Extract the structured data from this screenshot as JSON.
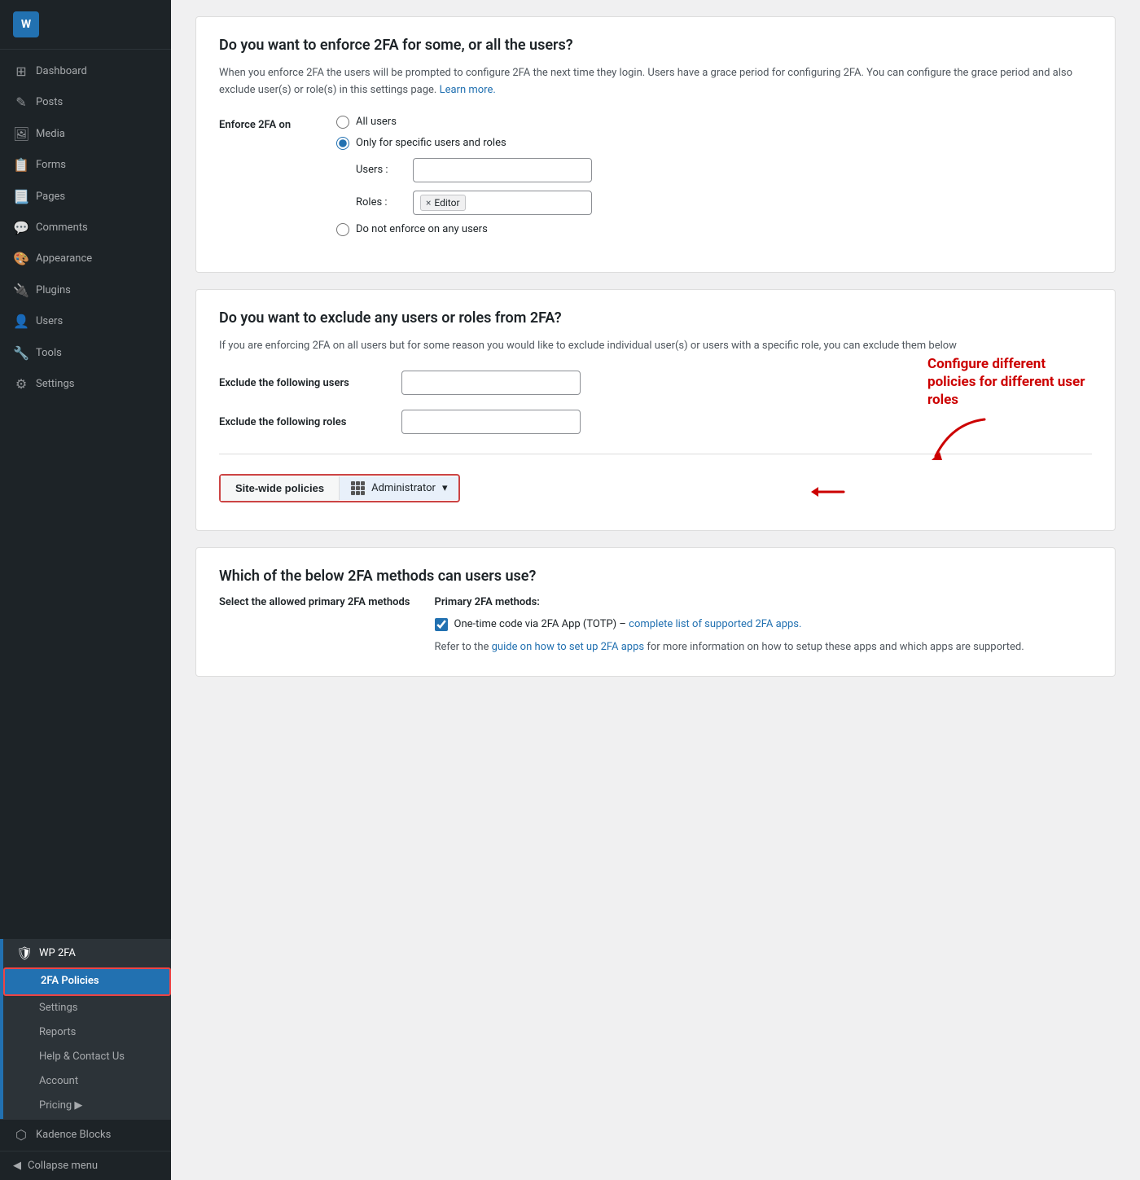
{
  "sidebar": {
    "logo": {
      "text": "W"
    },
    "items": [
      {
        "id": "dashboard",
        "label": "Dashboard",
        "icon": "⊞"
      },
      {
        "id": "posts",
        "label": "Posts",
        "icon": "📄"
      },
      {
        "id": "media",
        "label": "Media",
        "icon": "🖼"
      },
      {
        "id": "forms",
        "label": "Forms",
        "icon": "📋"
      },
      {
        "id": "pages",
        "label": "Pages",
        "icon": "📃"
      },
      {
        "id": "comments",
        "label": "Comments",
        "icon": "💬"
      },
      {
        "id": "appearance",
        "label": "Appearance",
        "icon": "🎨"
      },
      {
        "id": "plugins",
        "label": "Plugins",
        "icon": "🔌"
      },
      {
        "id": "users",
        "label": "Users",
        "icon": "👤"
      },
      {
        "id": "tools",
        "label": "Tools",
        "icon": "🔧"
      },
      {
        "id": "settings",
        "label": "Settings",
        "icon": "⚙"
      }
    ],
    "wp2fa": {
      "label": "WP 2FA",
      "icon": "🛡"
    },
    "submenu": [
      {
        "id": "2fa-policies",
        "label": "2FA Policies",
        "active": true
      },
      {
        "id": "settings",
        "label": "Settings"
      },
      {
        "id": "reports",
        "label": "Reports"
      },
      {
        "id": "help",
        "label": "Help & Contact Us"
      },
      {
        "id": "account",
        "label": "Account"
      },
      {
        "id": "pricing",
        "label": "Pricing ▶"
      }
    ],
    "kadence": {
      "label": "Kadence Blocks",
      "icon": "⬡"
    },
    "collapse": "Collapse menu"
  },
  "main": {
    "enforce_section": {
      "title": "Do you want to enforce 2FA for some, or all the users?",
      "description": "When you enforce 2FA the users will be prompted to configure 2FA the next time they login. Users have a grace period for configuring 2FA. You can configure the grace period and also exclude user(s) or role(s) in this settings page.",
      "learn_more": "Learn more.",
      "enforce_label": "Enforce 2FA on",
      "radio_options": [
        {
          "id": "all",
          "label": "All users",
          "checked": false
        },
        {
          "id": "specific",
          "label": "Only for specific users and roles",
          "checked": true
        },
        {
          "id": "none",
          "label": "Do not enforce on any users",
          "checked": false
        }
      ],
      "users_label": "Users :",
      "roles_label": "Roles :",
      "roles_tag": "Editor"
    },
    "exclude_section": {
      "title": "Do you want to exclude any users or roles from 2FA?",
      "description": "If you are enforcing 2FA on all users but for some reason you would like to exclude individual user(s) or users with a specific role, you can exclude them below",
      "exclude_users_label": "Exclude the following users",
      "exclude_roles_label": "Exclude the following roles",
      "annotation": {
        "text": "Configure different policies for different user roles",
        "arrow": "↙"
      }
    },
    "tabs": {
      "site_wide": "Site-wide policies",
      "administrator": "Administrator",
      "dropdown_icon": "▾"
    },
    "methods_section": {
      "title": "Which of the below 2FA methods can users use?",
      "select_label": "Select the allowed primary 2FA methods",
      "primary_label": "Primary 2FA methods:",
      "totp_label": "One-time code via 2FA App (TOTP) –",
      "totp_link": "complete list of supported 2FA apps.",
      "hint_prefix": "Refer to the",
      "hint_link": "guide on how to set up 2FA apps",
      "hint_suffix": "for more information on how to setup these apps and which apps are supported."
    }
  }
}
